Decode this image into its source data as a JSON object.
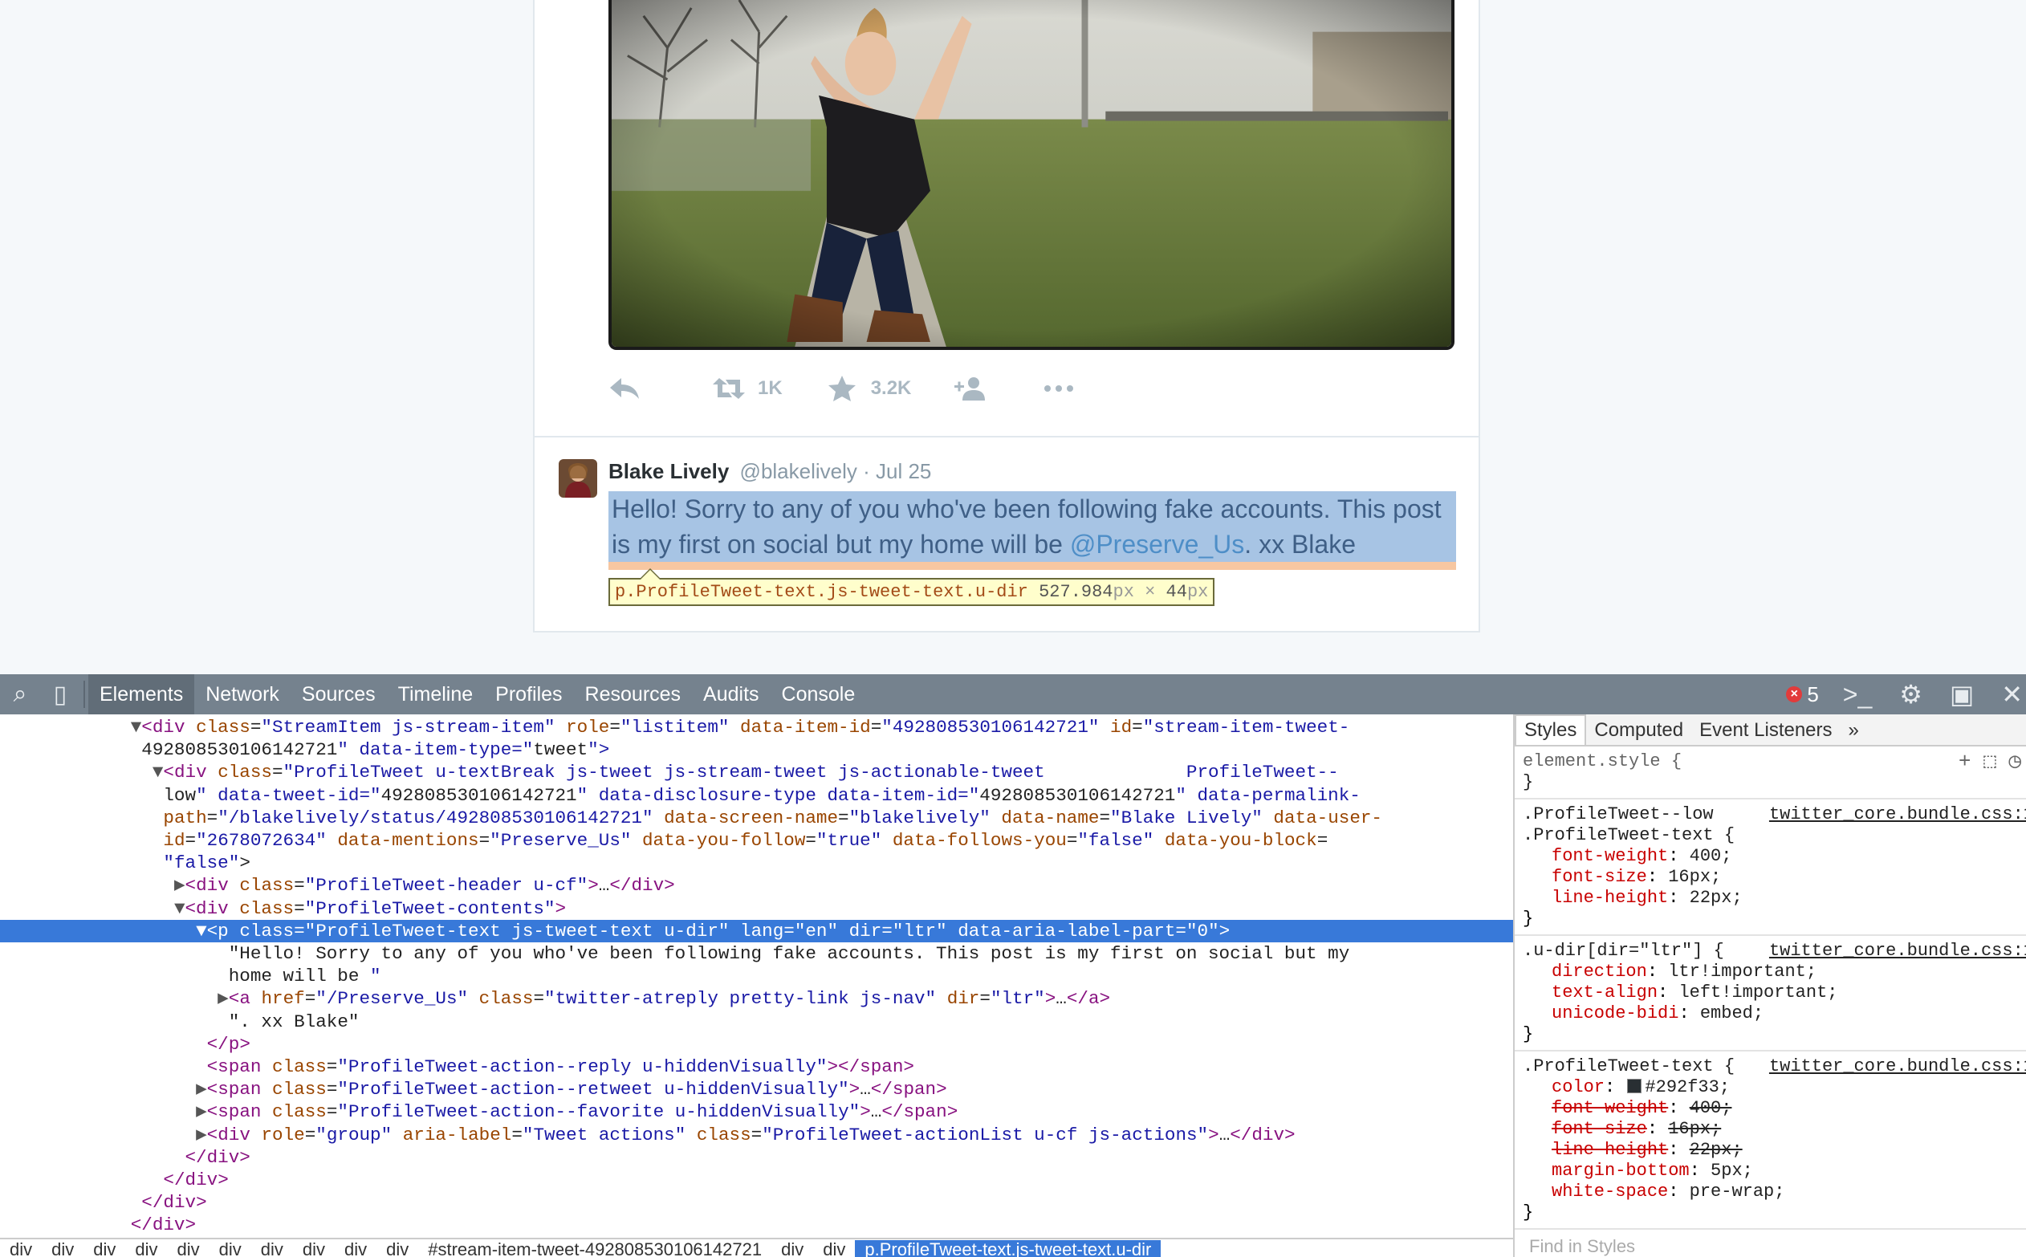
{
  "tweet_actions": {
    "retweet_count": "1K",
    "favorite_count": "3.2K"
  },
  "tweet": {
    "name": "Blake Lively",
    "screen_name": "@blakelively",
    "time": "· Jul 25",
    "text_before": "Hello! Sorry to any of you who've been following fake accounts. This post is my first on social but my home will be ",
    "mention": "@Preserve_Us",
    "text_after": ". xx Blake"
  },
  "tooltip": {
    "selector": "p.ProfileTweet-text.js-tweet-text.u-dir",
    "width": "527.984",
    "times": " × ",
    "height": "44",
    "unit": "px"
  },
  "devtools": {
    "tabs": [
      "Elements",
      "Network",
      "Sources",
      "Timeline",
      "Profiles",
      "Resources",
      "Audits",
      "Console"
    ],
    "active_tab": "Elements",
    "error_count": "5",
    "dom_lines": [
      {
        "indent": 13,
        "tri": "▼",
        "html": "<div class=\"StreamItem js-stream-item\" role=\"listitem\" data-item-id=\"492808530106142721\" id=\"stream-item-tweet-"
      },
      {
        "indent": 13,
        "tri": "",
        "html": "492808530106142721\" data-item-type=\"tweet\">"
      },
      {
        "indent": 15,
        "tri": "▼",
        "html": "<div class=\"ProfileTweet u-textBreak js-tweet js-stream-tweet js-actionable-tweet             ProfileTweet--"
      },
      {
        "indent": 15,
        "tri": "",
        "html": "low\" data-tweet-id=\"492808530106142721\" data-disclosure-type data-item-id=\"492808530106142721\" data-permalink-"
      },
      {
        "indent": 15,
        "tri": "",
        "html": "path=\"/blakelively/status/492808530106142721\" data-screen-name=\"blakelively\" data-name=\"Blake Lively\" data-user-"
      },
      {
        "indent": 15,
        "tri": "",
        "html": "id=\"2678072634\" data-mentions=\"Preserve_Us\" data-you-follow=\"true\" data-follows-you=\"false\" data-you-block="
      },
      {
        "indent": 15,
        "tri": "",
        "html": "\"false\">"
      },
      {
        "indent": 17,
        "tri": "▶",
        "html": "<div class=\"ProfileTweet-header u-cf\">…</div>"
      },
      {
        "indent": 17,
        "tri": "▼",
        "html": "<div class=\"ProfileTweet-contents\">"
      },
      {
        "indent": 19,
        "tri": "▼",
        "html": "<p class=\"ProfileTweet-text js-tweet-text u-dir\" lang=\"en\" dir=\"ltr\" data-aria-label-part=\"0\">",
        "selected": true
      },
      {
        "indent": 21,
        "tri": "",
        "html": "\"Hello! Sorry to any of you who've been following fake accounts. This post is my first on social but my"
      },
      {
        "indent": 21,
        "tri": "",
        "html": "home will be \""
      },
      {
        "indent": 21,
        "tri": "▶",
        "html": "<a href=\"/Preserve_Us\" class=\"twitter-atreply pretty-link js-nav\" dir=\"ltr\">…</a>"
      },
      {
        "indent": 21,
        "tri": "",
        "html": "\". xx Blake\""
      },
      {
        "indent": 19,
        "tri": "",
        "html": "</p>"
      },
      {
        "indent": 19,
        "tri": "",
        "html": "<span class=\"ProfileTweet-action--reply u-hiddenVisually\"></span>"
      },
      {
        "indent": 19,
        "tri": "▶",
        "html": "<span class=\"ProfileTweet-action--retweet u-hiddenVisually\">…</span>"
      },
      {
        "indent": 19,
        "tri": "▶",
        "html": "<span class=\"ProfileTweet-action--favorite u-hiddenVisually\">…</span>"
      },
      {
        "indent": 19,
        "tri": "▶",
        "html": "<div role=\"group\" aria-label=\"Tweet actions\" class=\"ProfileTweet-actionList u-cf js-actions\">…</div>"
      },
      {
        "indent": 17,
        "tri": "",
        "html": "</div>"
      },
      {
        "indent": 15,
        "tri": "",
        "html": "</div>"
      },
      {
        "indent": 13,
        "tri": "",
        "html": "</div>"
      },
      {
        "indent": 12,
        "tri": "",
        "html": "</div>"
      }
    ],
    "breadcrumb": [
      "div",
      "div",
      "div",
      "div",
      "div",
      "div",
      "div",
      "div",
      "div",
      "div",
      "#stream-item-tweet-492808530106142721",
      "div",
      "div",
      "p.ProfileTweet-text.js-tweet-text.u-dir"
    ],
    "sidebar_tabs": [
      "Styles",
      "Computed",
      "Event Listeners",
      "»"
    ],
    "element_style": "element.style {",
    "close_brace": "}",
    "rules": [
      {
        "selector_lines": [
          ".ProfileTweet--low",
          ".ProfileTweet-text {"
        ],
        "source": "twitter_core.bundle.css:1",
        "props": [
          {
            "name": "font-weight",
            "value": "400;",
            "struck": false
          },
          {
            "name": "font-size",
            "value": "16px;",
            "struck": false
          },
          {
            "name": "line-height",
            "value": "22px;",
            "struck": false
          }
        ]
      },
      {
        "selector_lines": [
          ".u-dir[dir=\"ltr\"] {"
        ],
        "source": "twitter_core.bundle.css:1",
        "props": [
          {
            "name": "direction",
            "value": "ltr!important;",
            "struck": false
          },
          {
            "name": "text-align",
            "value": "left!important;",
            "struck": false
          },
          {
            "name": "unicode-bidi",
            "value": "embed;",
            "struck": false
          }
        ]
      },
      {
        "selector_lines": [
          ".ProfileTweet-text {"
        ],
        "source": "twitter_core.bundle.css:1",
        "props": [
          {
            "name": "color",
            "value": "#292f33;",
            "struck": false,
            "swatch": "#292f33"
          },
          {
            "name": "font-weight",
            "value": "400;",
            "struck": true
          },
          {
            "name": "font-size",
            "value": "16px;",
            "struck": true
          },
          {
            "name": "line-height",
            "value": "22px;",
            "struck": true
          },
          {
            "name": "margin-bottom",
            "value": "5px;",
            "struck": false
          },
          {
            "name": "white-space",
            "value": "pre-wrap;",
            "struck": false
          }
        ]
      }
    ],
    "find_placeholder": "Find in Styles"
  }
}
